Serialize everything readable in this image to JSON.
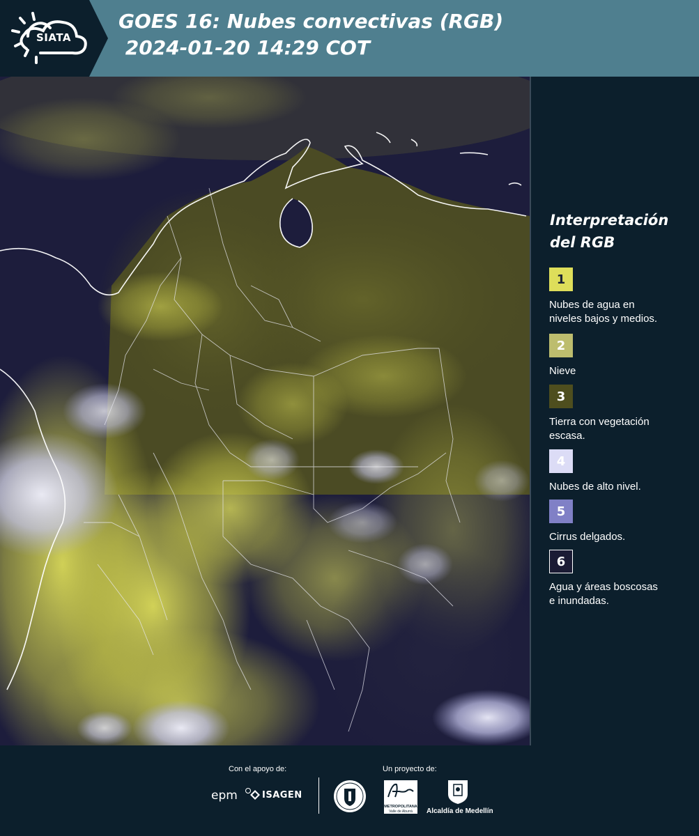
{
  "header": {
    "logo_text": "SIATA",
    "title": "GOES 16: Nubes convectivas (RGB)\n 2024-01-20 14:29 COT"
  },
  "legend": {
    "title": "Interpretación\ndel RGB",
    "items": [
      {
        "number": "1",
        "label": "Nubes de agua en\nniveles bajos y medios.",
        "color": "#dede5a",
        "text_color": "#1c2433"
      },
      {
        "number": "2",
        "label": "Nieve",
        "color": "#bdbd6e",
        "text_color": "#ffffff"
      },
      {
        "number": "3",
        "label": "Tierra con vegetación\nescasa.",
        "color": "#4e4e1e",
        "text_color": "#ffffff"
      },
      {
        "number": "4",
        "label": "Nubes de alto nivel.",
        "color": "#dcdcf6",
        "text_color": "#ffffff"
      },
      {
        "number": "5",
        "label": "Cirrus delgados.",
        "color": "#8080c6",
        "text_color": "#ffffff"
      },
      {
        "number": "6",
        "label": "Agua y áreas boscosas\ne inundadas.",
        "color": "#1b1b34",
        "text_color": "#ffffff"
      }
    ]
  },
  "footer": {
    "support_label": "Con el apoyo de:",
    "project_label": "Un proyecto de:",
    "sponsor_1": "epm",
    "sponsor_2": "ISAGEN",
    "partner_1_line1": "METROPOLITANA",
    "partner_1_line2": "Valle de Aburrá",
    "partner_2": "Alcaldía de Medellín"
  }
}
